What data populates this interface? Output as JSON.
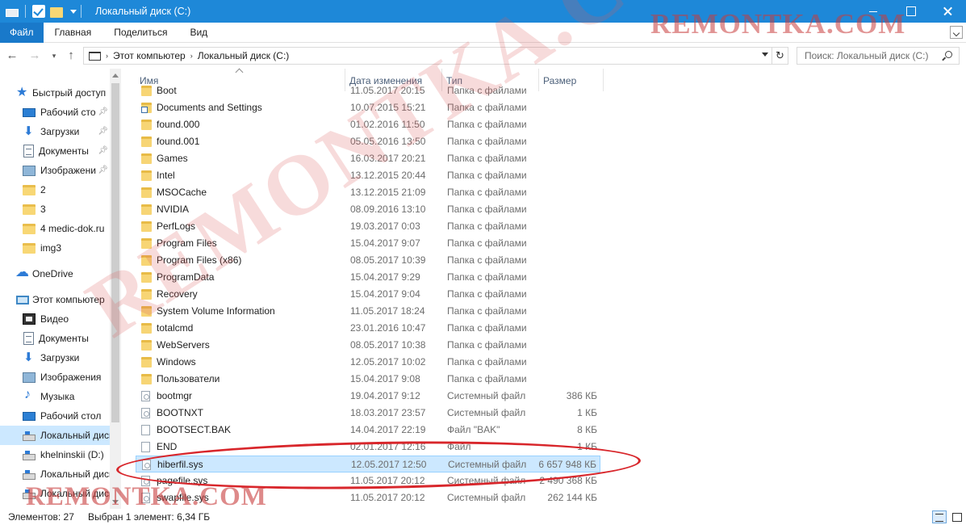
{
  "window": {
    "title": "Локальный диск (C:)"
  },
  "ribbon": {
    "tabs": [
      "Файл",
      "Главная",
      "Поделиться",
      "Вид"
    ]
  },
  "address": {
    "crumbs": [
      "Этот компьютер",
      "Локальный диск (C:)"
    ],
    "search_placeholder": "Поиск: Локальный диск (C:)"
  },
  "nav": {
    "items": [
      {
        "label": "Быстрый доступ",
        "icon": "star-icon",
        "pinned": false
      },
      {
        "label": "Рабочий сто",
        "icon": "desktop-icon",
        "pinned": true
      },
      {
        "label": "Загрузки",
        "icon": "downloads-icon",
        "pinned": true
      },
      {
        "label": "Документы",
        "icon": "documents-icon",
        "pinned": true
      },
      {
        "label": "Изображени",
        "icon": "pictures-icon",
        "pinned": true
      },
      {
        "label": "2",
        "icon": "folder-icon",
        "pinned": false
      },
      {
        "label": "3",
        "icon": "folder-icon",
        "pinned": false
      },
      {
        "label": "4 medic-dok.ru",
        "icon": "folder-icon",
        "pinned": false
      },
      {
        "label": "img3",
        "icon": "folder-icon",
        "pinned": false
      },
      {
        "label": "OneDrive",
        "icon": "cloud-icon",
        "pinned": false
      },
      {
        "label": "Этот компьютер",
        "icon": "computer-icon",
        "pinned": false
      },
      {
        "label": "Видео",
        "icon": "video-icon",
        "pinned": false
      },
      {
        "label": "Документы",
        "icon": "documents-icon",
        "pinned": false
      },
      {
        "label": "Загрузки",
        "icon": "downloads-icon",
        "pinned": false
      },
      {
        "label": "Изображения",
        "icon": "pictures-icon",
        "pinned": false
      },
      {
        "label": "Музыка",
        "icon": "music-icon",
        "pinned": false
      },
      {
        "label": "Рабочий стол",
        "icon": "desktop-icon",
        "pinned": false
      },
      {
        "label": "Локальный диск",
        "icon": "drive-icon",
        "pinned": false,
        "selected": true
      },
      {
        "label": "khelninskii (D:)",
        "icon": "drive-icon",
        "pinned": false
      },
      {
        "label": "Локальный диск",
        "icon": "drive-icon",
        "pinned": false
      },
      {
        "label": "Локальный диск",
        "icon": "drive-icon",
        "pinned": false
      }
    ]
  },
  "columns": {
    "name": "Имя",
    "date": "Дата изменения",
    "type": "Тип",
    "size": "Размер"
  },
  "files": [
    {
      "name": "Boot",
      "date": "11.05.2017 20:15",
      "type": "Папка с файлами",
      "size": "",
      "kind": "folder"
    },
    {
      "name": "Documents and Settings",
      "date": "10.07.2015 15:21",
      "type": "Папка с файлами",
      "size": "",
      "kind": "folder-link"
    },
    {
      "name": "found.000",
      "date": "01.02.2016 11:50",
      "type": "Папка с файлами",
      "size": "",
      "kind": "folder"
    },
    {
      "name": "found.001",
      "date": "05.05.2016 13:50",
      "type": "Папка с файлами",
      "size": "",
      "kind": "folder"
    },
    {
      "name": "Games",
      "date": "16.03.2017 20:21",
      "type": "Папка с файлами",
      "size": "",
      "kind": "folder"
    },
    {
      "name": "Intel",
      "date": "13.12.2015 20:44",
      "type": "Папка с файлами",
      "size": "",
      "kind": "folder"
    },
    {
      "name": "MSOCache",
      "date": "13.12.2015 21:09",
      "type": "Папка с файлами",
      "size": "",
      "kind": "folder"
    },
    {
      "name": "NVIDIA",
      "date": "08.09.2016 13:10",
      "type": "Папка с файлами",
      "size": "",
      "kind": "folder"
    },
    {
      "name": "PerfLogs",
      "date": "19.03.2017 0:03",
      "type": "Папка с файлами",
      "size": "",
      "kind": "folder"
    },
    {
      "name": "Program Files",
      "date": "15.04.2017 9:07",
      "type": "Папка с файлами",
      "size": "",
      "kind": "folder"
    },
    {
      "name": "Program Files (x86)",
      "date": "08.05.2017 10:39",
      "type": "Папка с файлами",
      "size": "",
      "kind": "folder"
    },
    {
      "name": "ProgramData",
      "date": "15.04.2017 9:29",
      "type": "Папка с файлами",
      "size": "",
      "kind": "folder"
    },
    {
      "name": "Recovery",
      "date": "15.04.2017 9:04",
      "type": "Папка с файлами",
      "size": "",
      "kind": "folder"
    },
    {
      "name": "System Volume Information",
      "date": "11.05.2017 18:24",
      "type": "Папка с файлами",
      "size": "",
      "kind": "folder"
    },
    {
      "name": "totalcmd",
      "date": "23.01.2016 10:47",
      "type": "Папка с файлами",
      "size": "",
      "kind": "folder"
    },
    {
      "name": "WebServers",
      "date": "08.05.2017 10:38",
      "type": "Папка с файлами",
      "size": "",
      "kind": "folder"
    },
    {
      "name": "Windows",
      "date": "12.05.2017 10:02",
      "type": "Папка с файлами",
      "size": "",
      "kind": "folder"
    },
    {
      "name": "Пользователи",
      "date": "15.04.2017 9:08",
      "type": "Папка с файлами",
      "size": "",
      "kind": "folder"
    },
    {
      "name": "bootmgr",
      "date": "19.04.2017 9:12",
      "type": "Системный файл",
      "size": "386 КБ",
      "kind": "sysfile"
    },
    {
      "name": "BOOTNXT",
      "date": "18.03.2017 23:57",
      "type": "Системный файл",
      "size": "1 КБ",
      "kind": "sysfile"
    },
    {
      "name": "BOOTSECT.BAK",
      "date": "14.04.2017 22:19",
      "type": "Файл \"BAK\"",
      "size": "8 КБ",
      "kind": "file"
    },
    {
      "name": "END",
      "date": "02.01.2017 12:16",
      "type": "Файл",
      "size": "1 КБ",
      "kind": "file"
    },
    {
      "name": "hiberfil.sys",
      "date": "12.05.2017 12:50",
      "type": "Системный файл",
      "size": "6 657 948 КБ",
      "kind": "sysfile",
      "selected": true
    },
    {
      "name": "pagefile.sys",
      "date": "11.05.2017 20:12",
      "type": "Системный файл",
      "size": "2 490 368 КБ",
      "kind": "sysfile"
    },
    {
      "name": "swapfile.sys",
      "date": "11.05.2017 20:12",
      "type": "Системный файл",
      "size": "262 144 КБ",
      "kind": "sysfile"
    }
  ],
  "status": {
    "count": "Элементов: 27",
    "selection": "Выбран 1 элемент: 6,34 ГБ"
  },
  "watermark": {
    "text": "REMONTKA.COM",
    "color": "#c83232"
  },
  "colors": {
    "titlebar": "#1e88d8",
    "file_tab": "#1979ca",
    "selection": "#cce8ff",
    "annotation": "#d8262b"
  }
}
